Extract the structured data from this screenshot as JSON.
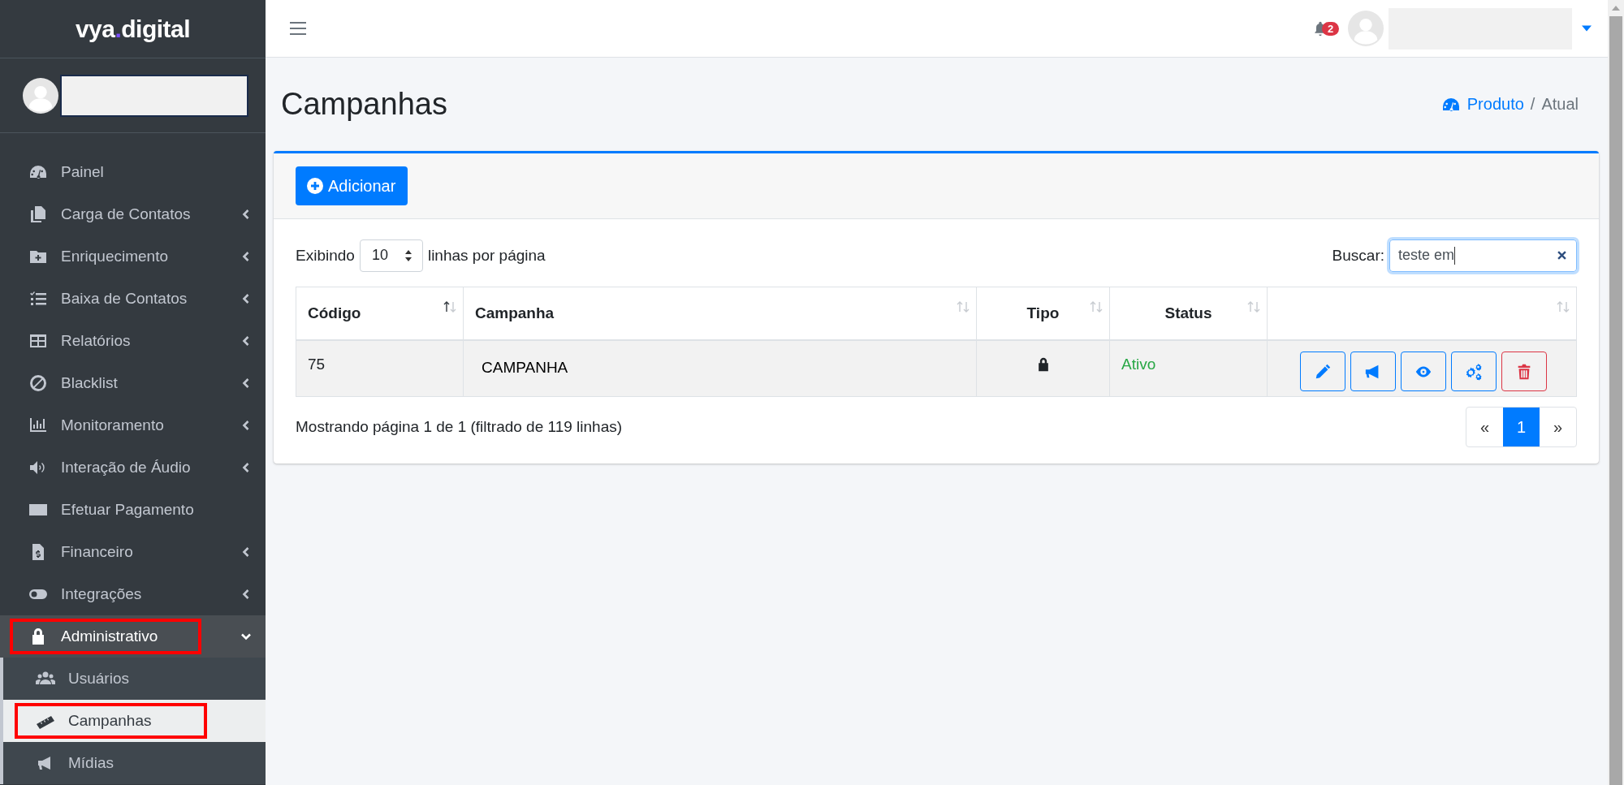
{
  "brand": {
    "text_before": "vya",
    "dot": ".",
    "text_after": "digital"
  },
  "sidebar": {
    "items": [
      {
        "label": "Painel",
        "kind": "link",
        "selected": false,
        "highlighted": false
      },
      {
        "label": "Carga de Contatos",
        "kind": "menu",
        "expanded": false,
        "selected": false,
        "highlighted": false
      },
      {
        "label": "Enriquecimento",
        "kind": "menu",
        "expanded": false,
        "selected": false,
        "highlighted": false
      },
      {
        "label": "Baixa de Contatos",
        "kind": "menu",
        "expanded": false,
        "selected": false,
        "highlighted": false
      },
      {
        "label": "Relatórios",
        "kind": "menu",
        "expanded": false,
        "selected": false,
        "highlighted": false
      },
      {
        "label": "Blacklist",
        "kind": "menu",
        "expanded": false,
        "selected": false,
        "highlighted": false
      },
      {
        "label": "Monitoramento",
        "kind": "menu",
        "expanded": false,
        "selected": false,
        "highlighted": false
      },
      {
        "label": "Interação de Áudio",
        "kind": "menu",
        "expanded": false,
        "selected": false,
        "highlighted": false
      },
      {
        "label": "Efetuar Pagamento",
        "kind": "link",
        "selected": false,
        "highlighted": false
      },
      {
        "label": "Financeiro",
        "kind": "menu",
        "expanded": false,
        "selected": false,
        "highlighted": false
      },
      {
        "label": "Integrações",
        "kind": "menu",
        "expanded": false,
        "selected": false,
        "highlighted": false
      },
      {
        "label": "Administrativo",
        "kind": "menu",
        "expanded": true,
        "selected": true,
        "highlighted": true,
        "children": [
          {
            "label": "Usuários",
            "selected": false,
            "highlighted": false
          },
          {
            "label": "Campanhas",
            "selected": true,
            "highlighted": true
          },
          {
            "label": "Mídias",
            "selected": false,
            "highlighted": false
          }
        ]
      }
    ]
  },
  "topbar": {
    "notifications": "2"
  },
  "page": {
    "title": "Campanhas",
    "breadcrumb": [
      {
        "label": "Produto",
        "kind": "link"
      },
      {
        "label": "Atual",
        "kind": "current"
      }
    ],
    "breadcrumb_separator": "/"
  },
  "card": {
    "add_button": "Adicionar",
    "length": {
      "prefix": "Exibindo",
      "value": "10",
      "suffix": "linhas por página"
    },
    "search": {
      "label": "Buscar:",
      "value": "teste em"
    },
    "table": {
      "columns": [
        {
          "label": "Código",
          "sorted": true
        },
        {
          "label": "Campanha",
          "sorted": false
        },
        {
          "label": "Tipo",
          "sorted": false
        },
        {
          "label": "Status",
          "sorted": false
        },
        {
          "sorted": false
        }
      ],
      "rows": [
        {
          "codigo": "75",
          "campanha": "CAMPANHA",
          "locked": true,
          "status": "Ativo",
          "active": true,
          "actions": [
            {
              "kind": "edit"
            },
            {
              "kind": "announce"
            },
            {
              "kind": "view"
            },
            {
              "kind": "settings"
            },
            {
              "kind": "delete"
            }
          ]
        }
      ]
    },
    "info": "Mostrando página 1 de 1 (filtrado de 119 linhas)",
    "pagination": [
      {
        "label": "«",
        "selected": false
      },
      {
        "label": "1",
        "selected": true
      },
      {
        "label": "»",
        "selected": false
      }
    ]
  }
}
